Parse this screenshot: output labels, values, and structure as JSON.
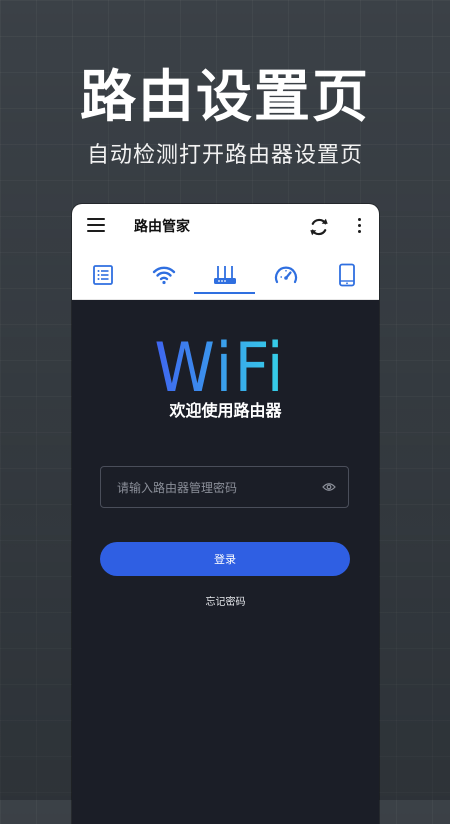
{
  "promo": {
    "headline": "路由设置页",
    "subline": "自动检测打开路由器设置页"
  },
  "app": {
    "title": "路由管家",
    "icons": {
      "menu": "hamburger-menu-icon",
      "refresh": "refresh-icon",
      "more": "more-vertical-icon"
    }
  },
  "tabs": [
    {
      "icon": "list-icon"
    },
    {
      "icon": "wifi-icon"
    },
    {
      "icon": "router-icon",
      "active": true
    },
    {
      "icon": "speedometer-icon"
    },
    {
      "icon": "phone-icon"
    }
  ],
  "login": {
    "logo_text": "WiFi",
    "welcome": "欢迎使用路由器",
    "password_placeholder": "请输入路由器管理密码",
    "login_label": "登录",
    "forgot_label": "忘记密码"
  },
  "colors": {
    "accent": "#2f6fe0",
    "button": "#2f5fe3",
    "screen_bg": "#1b1e27",
    "logo_cyan": "#35d4e8"
  }
}
